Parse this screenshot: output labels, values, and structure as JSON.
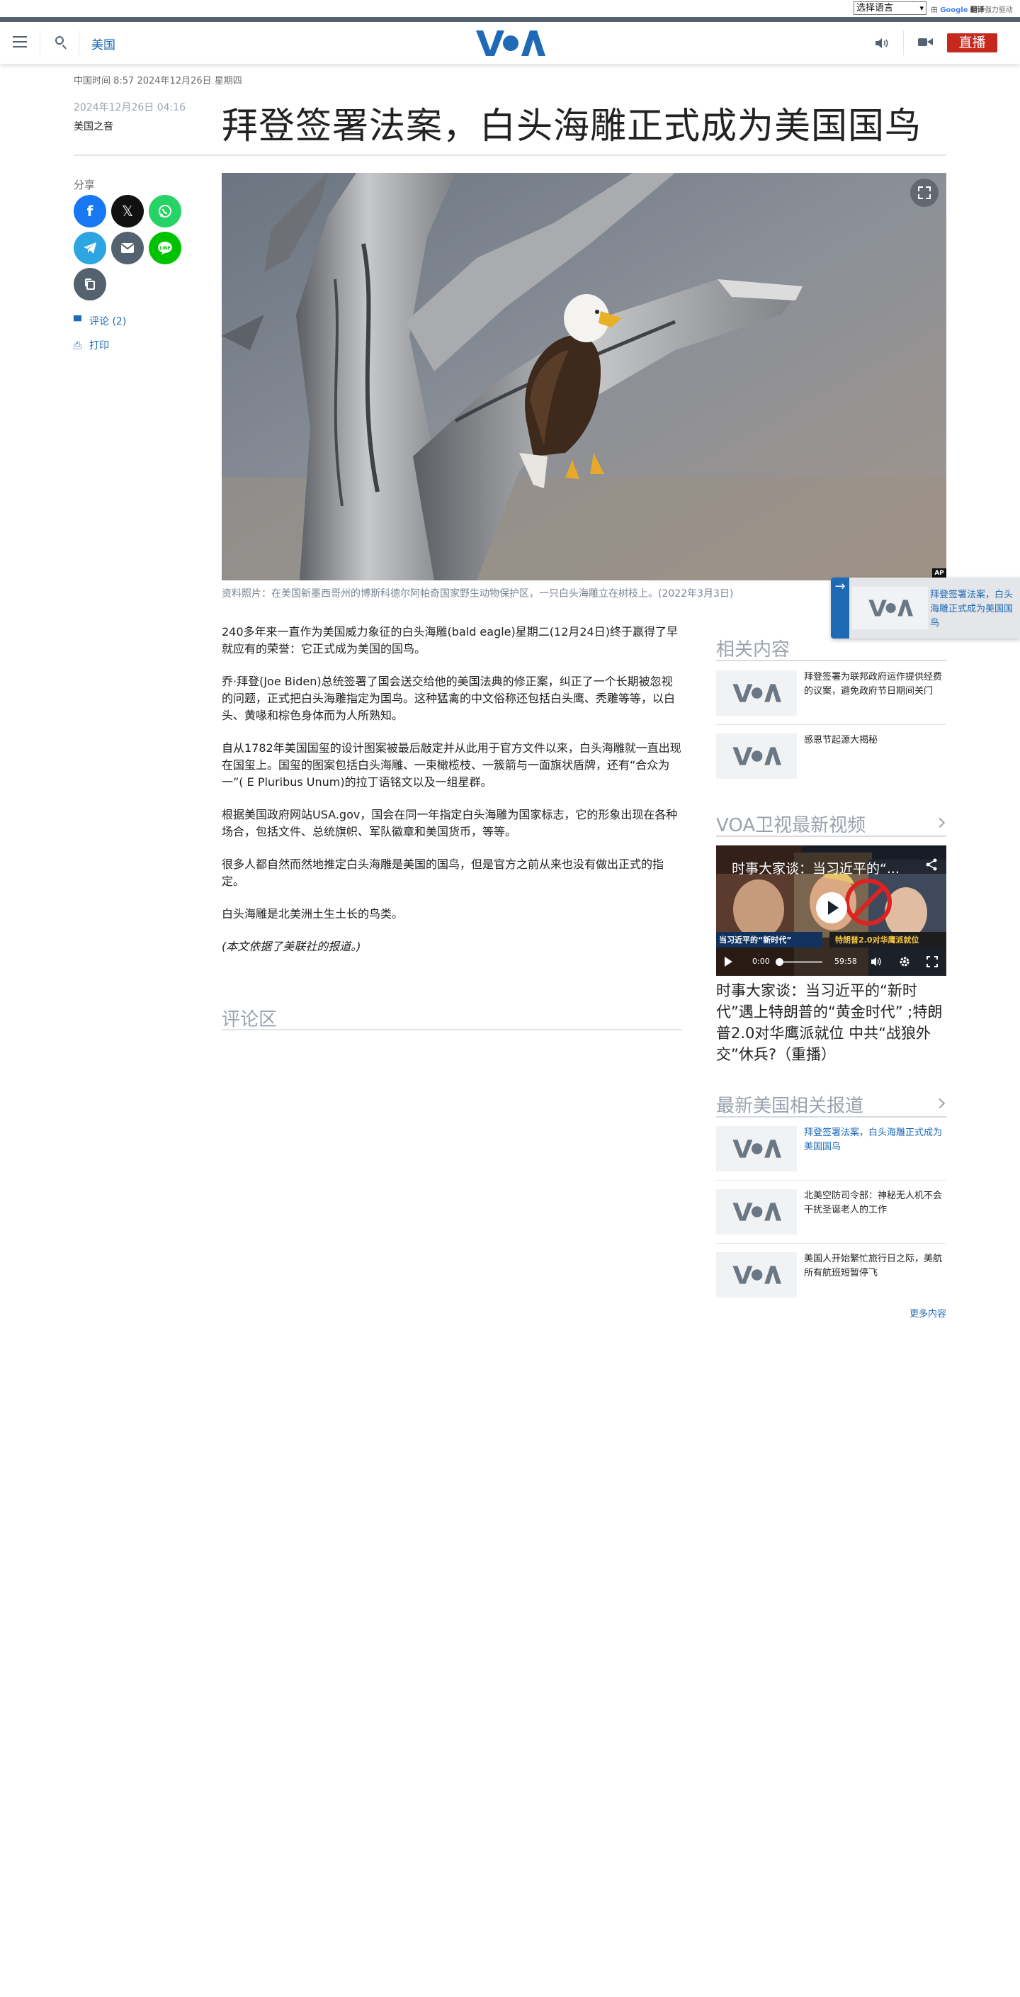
{
  "google_bar": {
    "language_select": "选择语言",
    "powered_prefix": "由",
    "powered_brand": "Google",
    "powered_translate": "翻译",
    "powered_suffix": "强力驱动"
  },
  "header": {
    "section": "美国",
    "logo_text": "VOA",
    "live_label": "直播"
  },
  "article": {
    "dateline": "中国时间 8:57 2024年12月26日 星期四",
    "published": "2024年12月26日 04:16",
    "author": "美国之音",
    "title": "拜登签署法案，白头海雕正式成为美国国鸟",
    "image_credit": "AP",
    "caption": "资料照片：在美国新墨西哥州的博斯科德尔阿帕奇国家野生动物保护区，一只白头海雕立在树枝上。(2022年3月3日)",
    "paragraphs": [
      "240多年来一直作为美国威力象征的白头海雕(bald eagle)星期二(12月24日)终于赢得了早就应有的荣誉：它正式成为美国的国鸟。",
      "乔·拜登(Joe Biden)总统签署了国会送交给他的美国法典的修正案，纠正了一个长期被忽视的问题，正式把白头海雕指定为国鸟。这种猛禽的中文俗称还包括白头鹰、秃雕等等，以白头、黄喙和棕色身体而为人所熟知。",
      "自从1782年美国国玺的设计图案被最后敲定并从此用于官方文件以来，白头海雕就一直出现在国玺上。国玺的图案包括白头海雕、一束橄榄枝、一簇箭与一面旗状盾牌，还有“合众为一”( E Pluribus Unum)的拉丁语铭文以及一组星群。",
      "根据美国政府网站USA.gov，国会在同一年指定白头海雕为国家标志，它的形象出现在各种场合，包括文件、总统旗帜、军队徽章和美国货币，等等。",
      "很多人都自然而然地推定白头海雕是美国的国鸟，但是官方之前从来也没有做出正式的指定。",
      "白头海雕是北美洲土生土长的鸟类。"
    ],
    "source_note": "(本文依据了美联社的报道。)",
    "comments_heading": "评论区"
  },
  "share": {
    "label": "分享",
    "comments_link": "评论 (2)",
    "print_link": "打印"
  },
  "float_card": {
    "title": "拜登签署法案，白头海雕正式成为美国国鸟"
  },
  "related": {
    "heading": "相关内容",
    "items": [
      {
        "title": "拜登签署为联邦政府运作提供经费的议案，避免政府节日期间关门"
      },
      {
        "title": "感恩节起源大揭秘"
      }
    ]
  },
  "video_section": {
    "heading": "VOA卫视最新视频",
    "overlay_title": "时事大家谈：当习近平的“...",
    "banner_left": "当习近平的“新时代”",
    "banner_right": "特朗普2.0对华鹰派就位",
    "time_current": "0:00",
    "time_total": "59:58",
    "progress": 0,
    "title": "时事大家谈：当习近平的“新时代”遇上特朗普的“黄金时代” ;特朗普2.0对华鹰派就位 中共“战狼外交”休兵?（重播）"
  },
  "latest": {
    "heading": "最新美国相关报道",
    "items": [
      {
        "title": "拜登签署法案，白头海雕正式成为美国国鸟"
      },
      {
        "title": "北美空防司令部：神秘无人机不会干扰圣诞老人的工作"
      },
      {
        "title": "美国人开始繁忙旅行日之际，美航所有航班短暂停飞"
      }
    ],
    "more": "更多内容"
  },
  "colors": {
    "brand_blue": "#1e6ab7",
    "live_red": "#c6281e",
    "header_gray": "#54616f"
  },
  "icons": [
    "hamburger-menu-icon",
    "search-icon",
    "speaker-icon",
    "video-camera-icon",
    "facebook-icon",
    "x-icon",
    "whatsapp-icon",
    "telegram-icon",
    "email-icon",
    "line-icon",
    "copy-link-icon",
    "comment-icon",
    "print-icon",
    "fullscreen-icon",
    "play-icon",
    "share-icon",
    "volume-icon",
    "settings-icon",
    "arrow-right-icon",
    "chevron-right-icon"
  ]
}
